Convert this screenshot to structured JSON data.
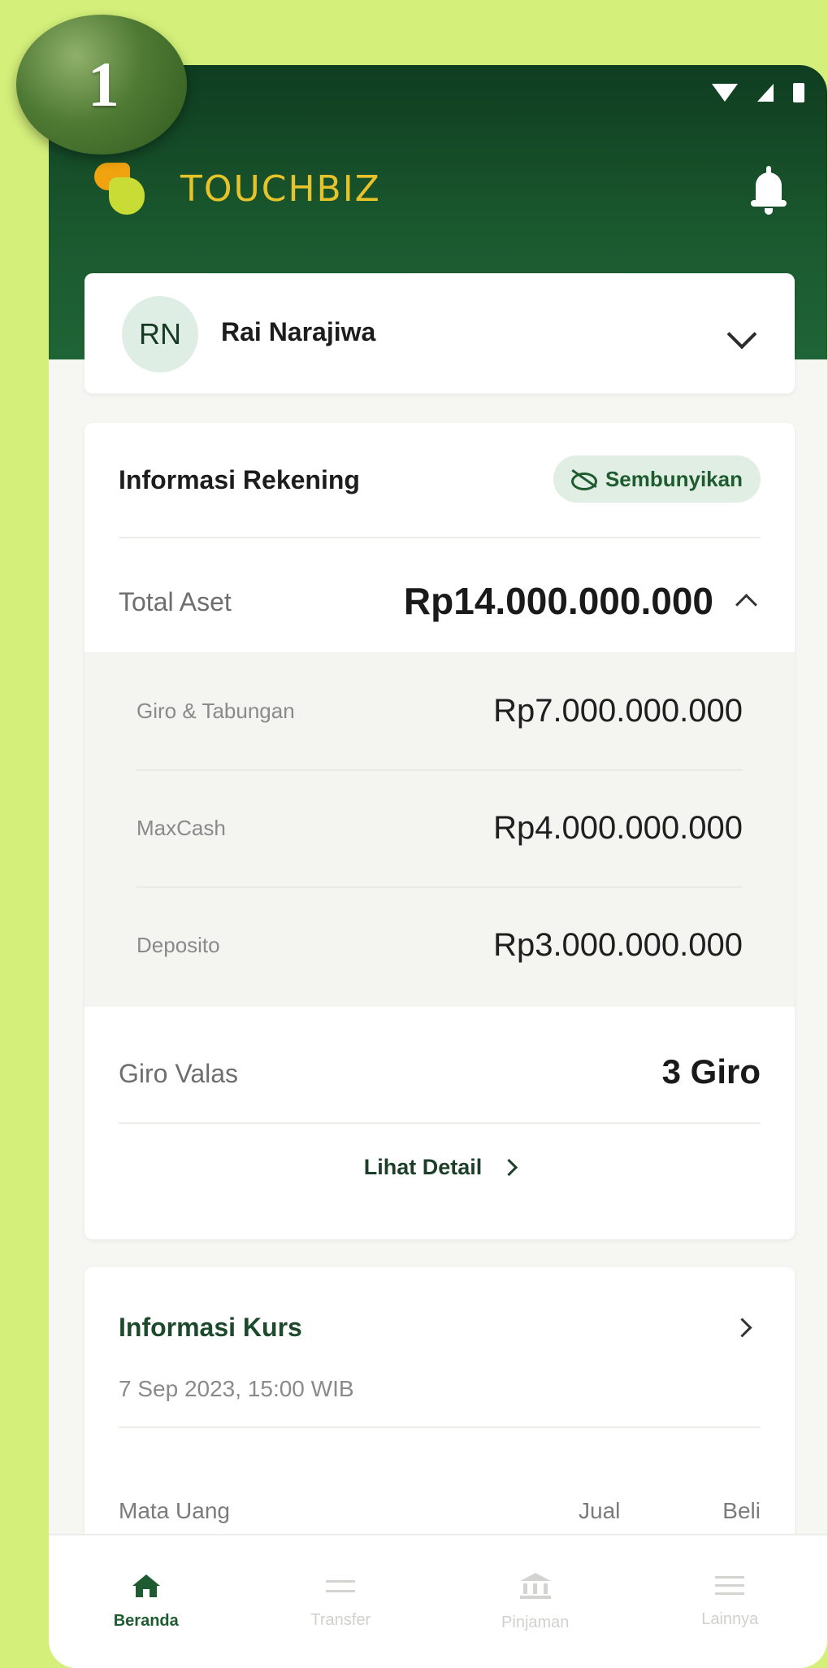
{
  "badge": {
    "number": "1"
  },
  "header": {
    "brand_name": "TOUCHBIZ"
  },
  "user": {
    "initials": "RN",
    "name": "Rai Narajiwa"
  },
  "account_info": {
    "title": "Informasi Rekening",
    "hide_label": "Sembunyikan",
    "total_label": "Total Aset",
    "total_value": "Rp14.000.000.000",
    "items": [
      {
        "label": "Giro & Tabungan",
        "value": "Rp7.000.000.000"
      },
      {
        "label": "MaxCash",
        "value": "Rp4.000.000.000"
      },
      {
        "label": "Deposito",
        "value": "Rp3.000.000.000"
      }
    ],
    "valas_label": "Giro Valas",
    "valas_value": "3 Giro",
    "detail_link": "Lihat Detail"
  },
  "exchange": {
    "title": "Informasi Kurs",
    "date": "7 Sep 2023, 15:00 WIB",
    "col_currency": "Mata Uang",
    "col_sell": "Jual",
    "col_buy": "Beli"
  },
  "bottom_nav": [
    {
      "label": "Beranda",
      "icon": "home-icon",
      "active": true
    },
    {
      "label": "Transfer",
      "icon": "transfer-icon",
      "active": false
    },
    {
      "label": "Pinjaman",
      "icon": "bank-icon",
      "active": false
    },
    {
      "label": "Lainnya",
      "icon": "menu-icon",
      "active": false
    }
  ],
  "colors": {
    "background": "#d4f07a",
    "header_green": "#1b5a2f",
    "brand_gold": "#e6c32a"
  }
}
